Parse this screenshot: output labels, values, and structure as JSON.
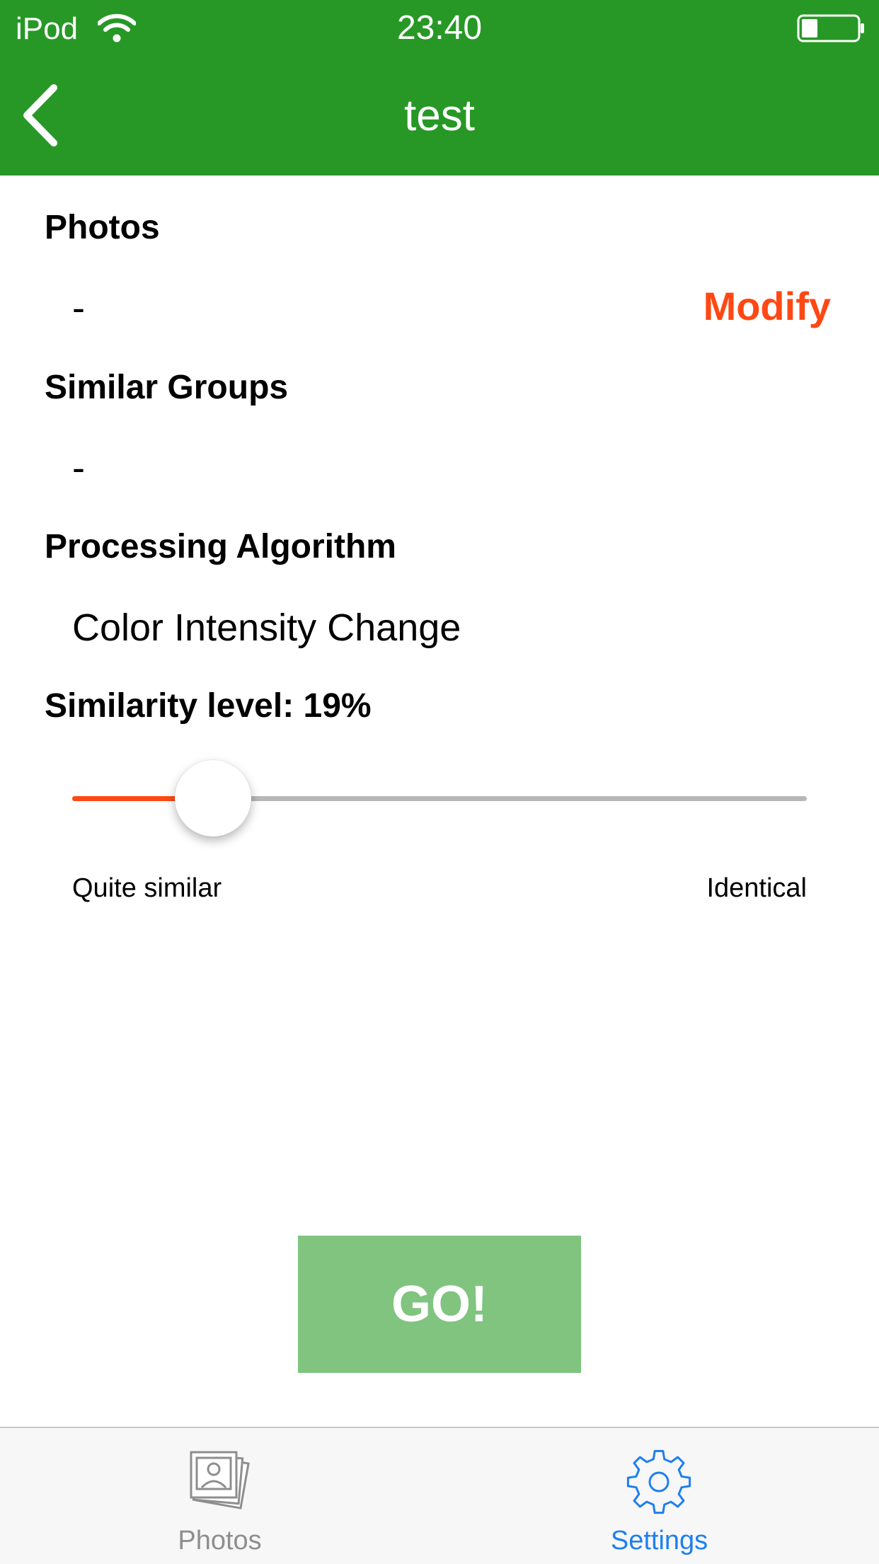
{
  "status_bar": {
    "carrier": "iPod",
    "time": "23:40"
  },
  "nav": {
    "title": "test",
    "back_icon": "chevron-left-icon"
  },
  "sections": {
    "photos": {
      "title": "Photos",
      "value": "-",
      "modify_label": "Modify"
    },
    "similar_groups": {
      "title": "Similar Groups",
      "value": "-"
    },
    "algorithm": {
      "title": "Processing Algorithm",
      "value": "Color Intensity Change"
    },
    "similarity": {
      "title": "Similarity level: 19%",
      "level_percent": 19,
      "min_label": "Quite similar",
      "max_label": "Identical"
    }
  },
  "go_button": {
    "label": "GO!"
  },
  "tabs": [
    {
      "label": "Photos",
      "icon": "photos-stack-icon",
      "selected": false
    },
    {
      "label": "Settings",
      "icon": "gear-icon",
      "selected": true
    }
  ],
  "colors": {
    "nav_bar": "#279826",
    "accent": "#ff4814",
    "go_button": "#80c480",
    "tab_selected": "#1e7ff0",
    "tab_unselected": "#8e8e8e"
  }
}
